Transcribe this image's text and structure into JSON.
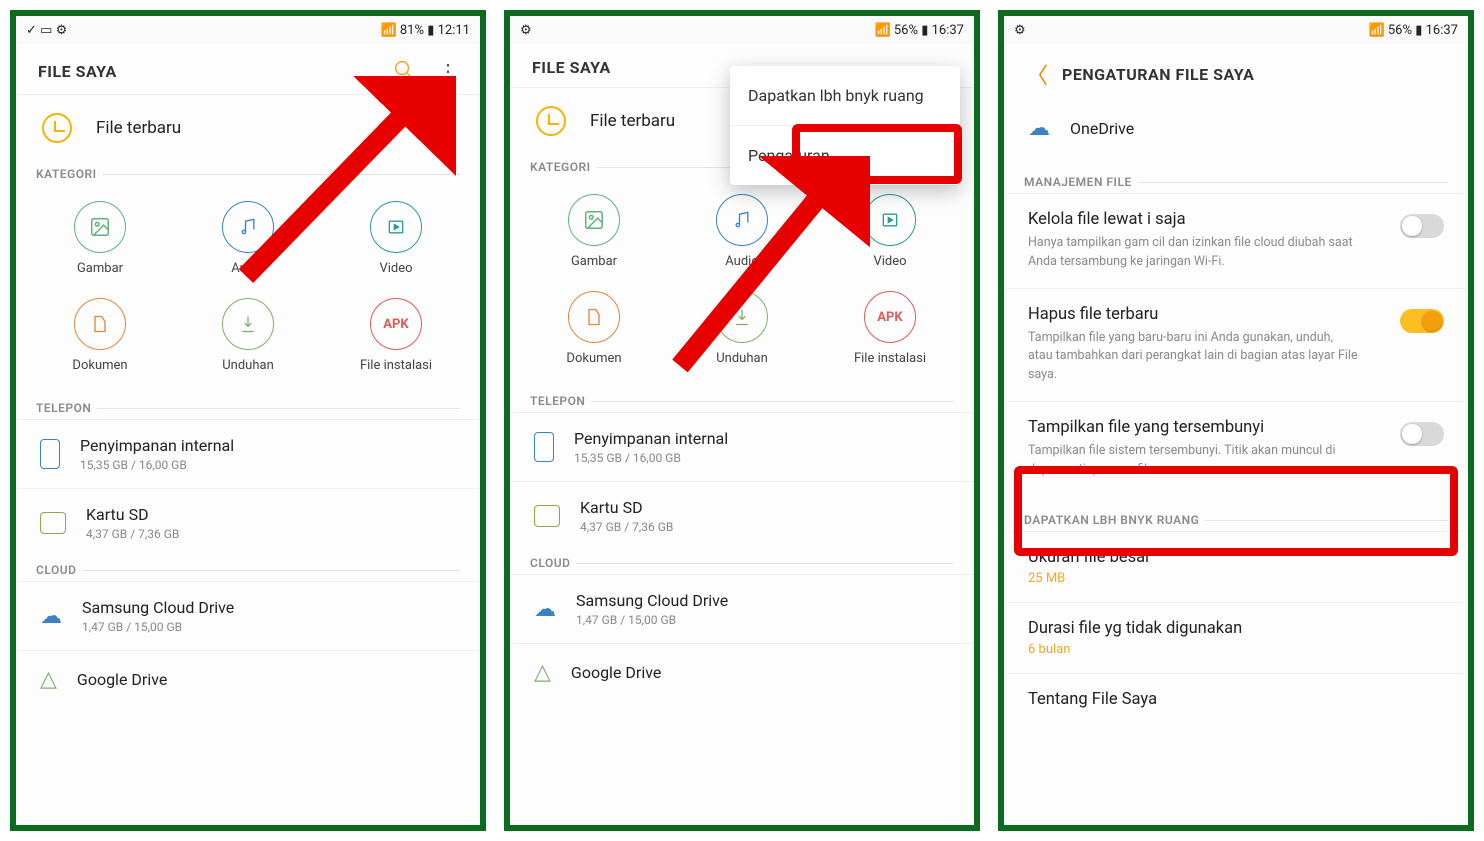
{
  "panel1": {
    "status": {
      "left": "✓ ▭ ⚙",
      "right": "📶 81% ▮ 12:11"
    },
    "app_title": "FILE SAYA",
    "recent": "File terbaru",
    "section_cat": "KATEGORI",
    "cats": {
      "gambar": "Gambar",
      "audio": "Audio",
      "video": "Video",
      "dokumen": "Dokumen",
      "unduhan": "Unduhan",
      "apk": "File instalasi",
      "apk_badge": "APK"
    },
    "section_phone": "TELEPON",
    "internal": {
      "label": "Penyimpanan internal",
      "sub": "15,35 GB / 16,00 GB"
    },
    "sd": {
      "label": "Kartu SD",
      "sub": "4,37 GB / 7,36 GB"
    },
    "section_cloud": "CLOUD",
    "samsung": {
      "label": "Samsung Cloud Drive",
      "sub": "1,47 GB / 15,00 GB"
    },
    "gdrive": {
      "label": "Google Drive"
    }
  },
  "panel2": {
    "status": {
      "left": "⚙",
      "right": "📶 56% ▮ 16:37"
    },
    "popup": {
      "opt1": "Dapatkan lbh bnyk ruang",
      "opt2": "Pengaturan"
    }
  },
  "panel3": {
    "status": {
      "left": "⚙",
      "right": "📶 56% ▮ 16:37"
    },
    "title": "PENGATURAN FILE SAYA",
    "onedrive": "OneDrive",
    "section_manage": "MANAJEMEN FILE",
    "wifi": {
      "title": "Kelola file lewat       i saja",
      "desc": "Hanya tampilkan gam      cil dan izinkan file cloud diubah saat Anda tersambung ke jaringan Wi-Fi."
    },
    "recent": {
      "title": "Hapus file terbaru",
      "desc": "Tampilkan file yang baru-baru ini Anda gunakan, unduh, atau tambahkan dari perangkat lain di bagian atas layar File saya."
    },
    "hidden": {
      "title": "Tampilkan file yang tersembunyi",
      "desc": "Tampilkan file sistem tersembunyi. Titik akan muncul di depan setiap nama file."
    },
    "section_space": "DAPATKAN LBH BNYK RUANG",
    "large": {
      "title": "Ukuran file besar",
      "value": "25 MB"
    },
    "unused": {
      "title": "Durasi file yg tidak digunakan",
      "value": "6 bulan"
    },
    "about": {
      "title": "Tentang File Saya"
    }
  }
}
